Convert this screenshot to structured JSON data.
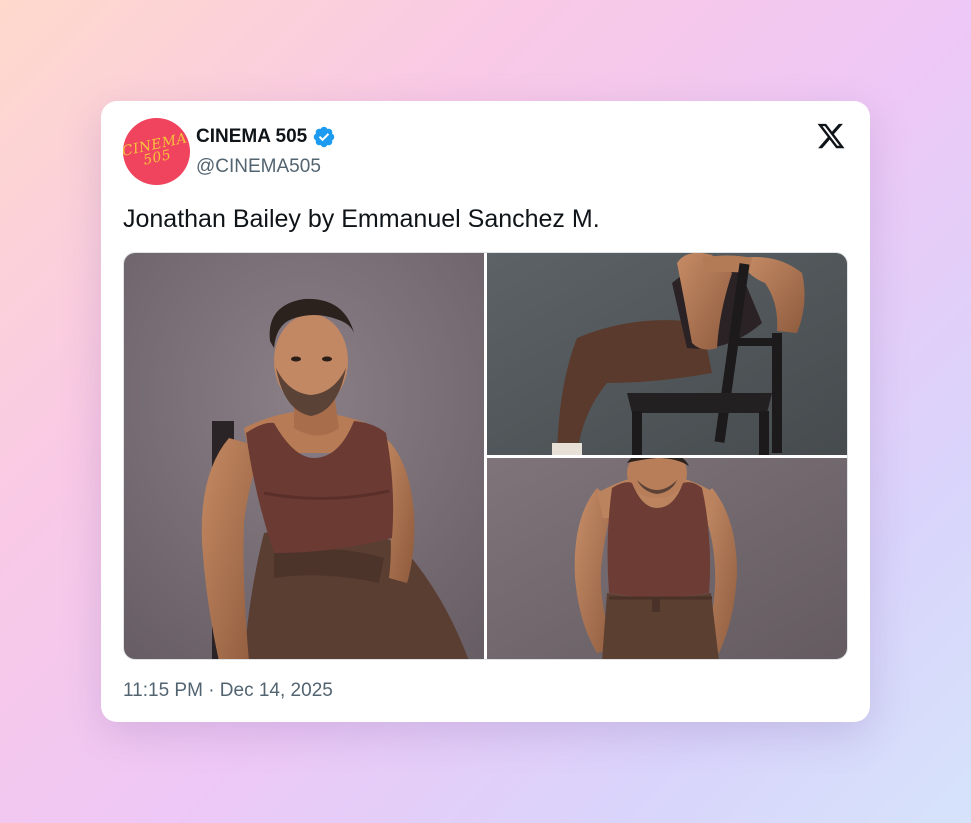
{
  "account": {
    "display_name": "CINEMA 505",
    "handle": "@CINEMA505",
    "verified": true,
    "avatar_text": "CINEMA\n505",
    "avatar_bg": "#f0435e",
    "avatar_text_color": "#f6c23b",
    "verified_color": "#1d9bf0"
  },
  "tweet": {
    "text": "Jonathan Bailey by Emmanuel Sanchez M.",
    "media_count": 3,
    "timestamp": "11:15 PM · Dec 14, 2025"
  },
  "icons": {
    "platform_logo": "x-logo-icon",
    "verified_badge": "verified-badge-icon"
  }
}
